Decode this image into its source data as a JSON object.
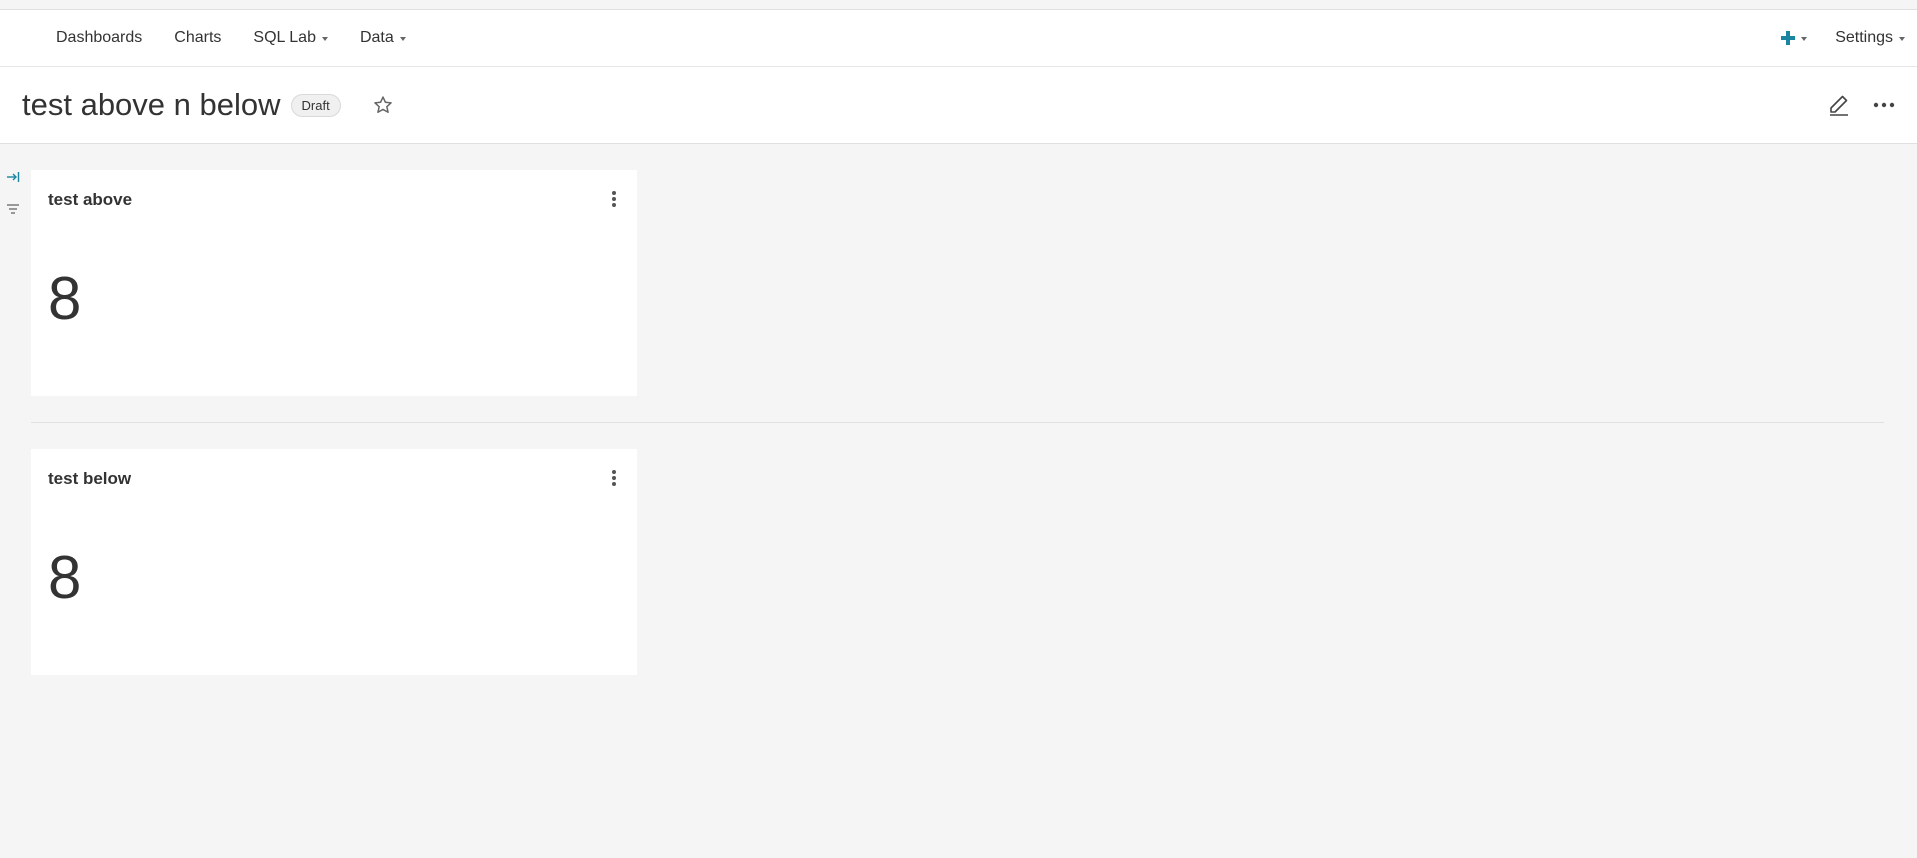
{
  "nav": {
    "items": [
      {
        "label": "Dashboards",
        "dropdown": false
      },
      {
        "label": "Charts",
        "dropdown": false
      },
      {
        "label": "SQL Lab",
        "dropdown": true
      },
      {
        "label": "Data",
        "dropdown": true
      }
    ],
    "add_icon": "plus-icon",
    "settings_label": "Settings"
  },
  "header": {
    "title": "test above n below",
    "badge": "Draft"
  },
  "cards": [
    {
      "title": "test above",
      "value": "8"
    },
    {
      "title": "test below",
      "value": "8"
    }
  ],
  "colors": {
    "accent": "#1a85a0",
    "background": "#f5f5f5"
  }
}
